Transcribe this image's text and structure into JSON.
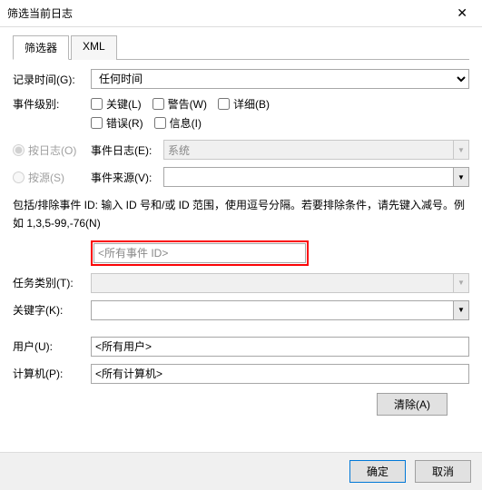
{
  "window": {
    "title": "筛选当前日志",
    "close": "✕"
  },
  "tabs": {
    "filter": "筛选器",
    "xml": "XML"
  },
  "labels": {
    "logged": "记录时间(G):",
    "level": "事件级别:",
    "bylog": "按日志(O)",
    "bysource": "按源(S)",
    "eventlogs": "事件日志(E):",
    "eventsources": "事件来源(V):",
    "task": "任务类别(T):",
    "keywords": "关键字(K):",
    "user": "用户(U):",
    "computer": "计算机(P):"
  },
  "loggedOptions": {
    "any": "任何时间"
  },
  "levels": {
    "critical": "关键(L)",
    "warning": "警告(W)",
    "verbose": "详细(B)",
    "error": "错误(R)",
    "info": "信息(I)"
  },
  "eventLogValue": "系统",
  "help": "包括/排除事件 ID: 输入 ID 号和/或 ID 范围，使用逗号分隔。若要排除条件，请先键入减号。例如 1,3,5-99,-76(N)",
  "idPlaceholder": "<所有事件 ID>",
  "userPlaceholder": "<所有用户>",
  "computerPlaceholder": "<所有计算机>",
  "buttons": {
    "clear": "清除(A)",
    "ok": "确定",
    "cancel": "取消"
  }
}
